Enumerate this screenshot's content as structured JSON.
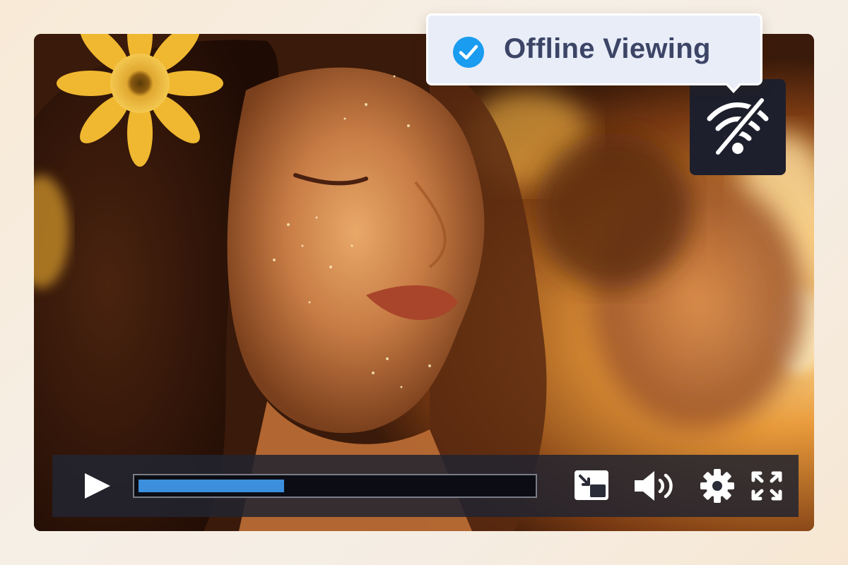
{
  "player": {
    "status_label": "Offline Viewing",
    "progress_fraction": 0.37,
    "accent_color": "#3c8fdc",
    "check_color": "#1a9cf0"
  },
  "icons": {
    "status": "check-circle-icon",
    "offline": "wifi-off-icon",
    "play": "play-icon",
    "pip": "picture-in-picture-icon",
    "volume": "volume-icon",
    "settings": "gear-icon",
    "fullscreen": "fullscreen-icon"
  }
}
